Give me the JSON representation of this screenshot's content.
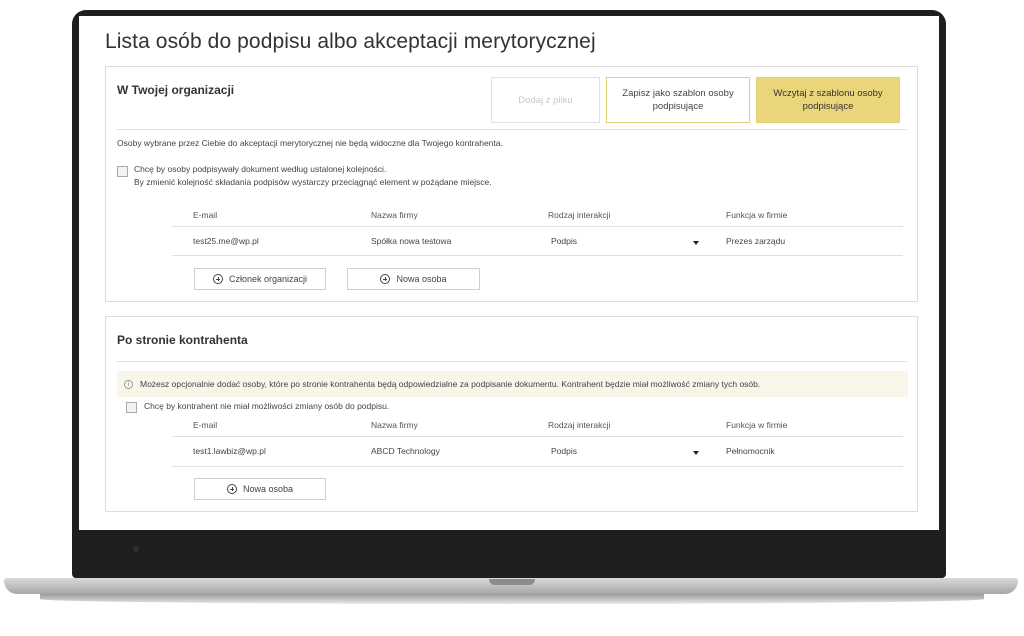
{
  "page": {
    "title": "Lista osób do podpisu albo akceptacji merytorycznej"
  },
  "organization": {
    "heading": "W Twojej organizacji",
    "buttons": {
      "from_file": "Dodaj z pliku",
      "save_template": "Zapisz jako szablon osoby podpisujące",
      "load_template": "Wczytaj z szablonu osoby podpisujące"
    },
    "note": "Osoby wybrane przez Ciebie do akceptacji merytorycznej nie będą widoczne dla Twojego kontrahenta.",
    "order_checkbox": {
      "line1": "Chcę by osoby podpisywały dokument według ustalonej kolejności.",
      "line2": "By zmienić kolejność składania podpisów wystarczy przeciągnąć element w pożądane miejsce."
    },
    "columns": [
      "E-mail",
      "Nazwa firmy",
      "Rodzaj interakcji",
      "Funkcja w firmie"
    ],
    "rows": [
      {
        "email": "test25.me@wp.pl",
        "company": "Spółka nowa testowa",
        "interaction": "Podpis",
        "role": "Prezes zarządu"
      }
    ],
    "add_member_label": "Członek organizacji",
    "add_person_label": "Nowa osoba"
  },
  "counterparty": {
    "heading": "Po stronie kontrahenta",
    "info": "Możesz opcjonalnie dodać osoby, które po stronie kontrahenta będą odpowiedzialne za podpisanie dokumentu. Kontrahent będzie miał możliwość zmiany tych osób.",
    "lock_checkbox": "Chcę by kontrahent nie miał możliwości zmiany osób do podpisu.",
    "columns": [
      "E-mail",
      "Nazwa firmy",
      "Rodzaj interakcji",
      "Funkcja w firmie"
    ],
    "rows": [
      {
        "email": "test1.lawbiz@wp.pl",
        "company": "ABCD Technology",
        "interaction": "Podpis",
        "role": "Pełnomocnik"
      }
    ],
    "add_person_label": "Nowa osoba"
  },
  "colors": {
    "gold": "#ead57a",
    "gold_border": "#e3cf7a",
    "info_bg": "#f8f5e9",
    "frame": "#1f1f1f"
  }
}
